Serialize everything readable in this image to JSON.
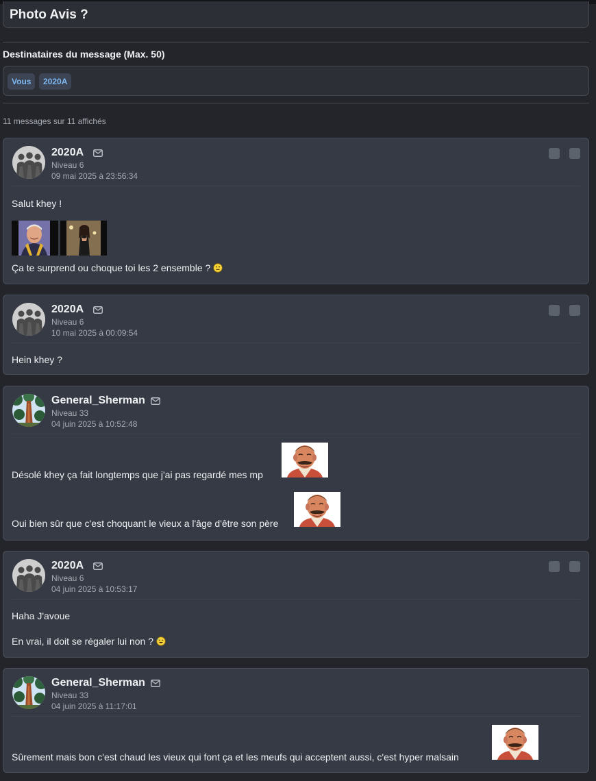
{
  "conversation": {
    "title": "Photo Avis ?"
  },
  "recipients": {
    "label": "Destinataires du message (Max. 50)",
    "chips": [
      "Vous",
      "2020A"
    ]
  },
  "summary": "11 messages sur 11 affichés",
  "icons": {
    "mail": "mail-icon",
    "quote": "quote-icon",
    "report": "report-icon"
  },
  "messages": [
    {
      "author": "2020A",
      "level": "Niveau 6",
      "date": "09 mai 2025 à 23:56:34",
      "paragraphs": [
        "Salut khey !",
        "Ça te surprend ou choque toi les 2 ensemble ?"
      ]
    },
    {
      "author": "2020A",
      "level": "Niveau 6",
      "date": "10 mai 2025 à 00:09:54",
      "paragraphs": [
        "Hein khey ?"
      ]
    },
    {
      "author": "General_Sherman",
      "level": "Niveau 33",
      "date": "04 juin 2025 à 10:52:48",
      "paragraphs": [
        "Désolé khey ça fait longtemps que j'ai pas regardé mes mp",
        "Oui bien sûr que c'est choquant le vieux a l'âge d'être son père"
      ]
    },
    {
      "author": "2020A",
      "level": "Niveau 6",
      "date": "04 juin 2025 à 10:53:17",
      "paragraphs": [
        "Haha J'avoue",
        "En vrai, il doit se régaler lui non ?"
      ]
    },
    {
      "author": "General_Sherman",
      "level": "Niveau 33",
      "date": "04 juin 2025 à 11:17:01",
      "paragraphs": [
        "Sûrement mais bon c'est chaud les vieux qui font ça et les meufs qui acceptent aussi, c'est hyper malsain"
      ]
    }
  ]
}
